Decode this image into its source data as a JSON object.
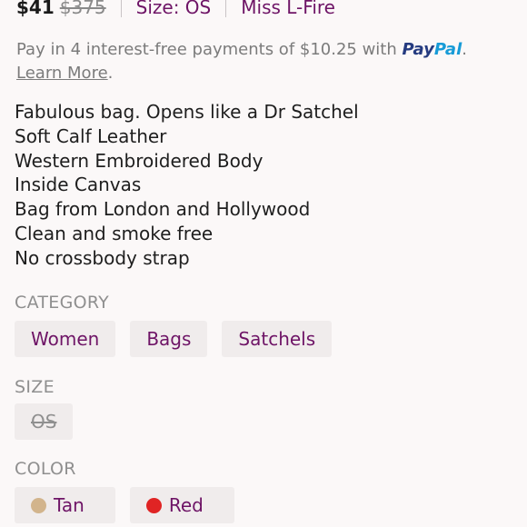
{
  "listing": {
    "price": "$41",
    "original_price": "$375",
    "size_label": "Size: OS",
    "brand": "Miss L-Fire"
  },
  "payment": {
    "text": "Pay in 4 interest-free payments of $10.25 with ",
    "paypal_pay": "Pay",
    "paypal_pal": "Pal",
    "period": ".",
    "learn_more": "Learn More",
    "after_link": "."
  },
  "description": [
    "Fabulous bag. Opens like a Dr Satchel",
    "Soft Calf Leather",
    "Western Embroidered Body",
    "Inside Canvas",
    "Bag from London and Hollywood",
    "Clean and smoke free",
    "No crossbody strap"
  ],
  "category": {
    "label": "CATEGORY",
    "chips": [
      "Women",
      "Bags",
      "Satchels"
    ]
  },
  "size": {
    "label": "SIZE",
    "chips": [
      "OS"
    ]
  },
  "color": {
    "label": "COLOR",
    "chips": [
      {
        "label": "Tan",
        "swatch": "#d2b48c"
      },
      {
        "label": "Red",
        "swatch": "#e02424"
      }
    ]
  }
}
